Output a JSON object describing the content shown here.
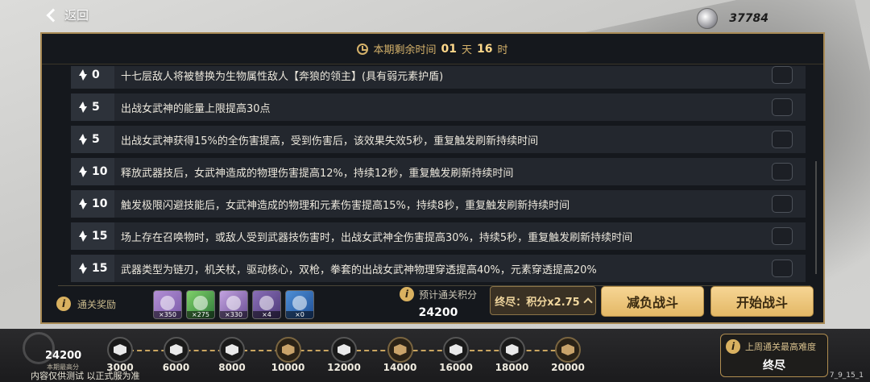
{
  "topbar": {
    "back_label": "返回",
    "currency_value": "37784",
    "currency_icon": "currency-emblem-icon"
  },
  "timer": {
    "prefix": "本期剩余时间",
    "days": "01",
    "day_unit": "天",
    "hours": "16",
    "hour_unit": "时"
  },
  "rules": [
    {
      "cost": "0",
      "text": "十七层敌人将被替换为生物属性敌人【奔狼的领主】(具有弱元素护盾)"
    },
    {
      "cost": "5",
      "text": "出战女武神的能量上限提高30点"
    },
    {
      "cost": "5",
      "text": "出战女武神获得15%的全伤害提高，受到伤害后，该效果失效5秒，重复触发刷新持续时间"
    },
    {
      "cost": "10",
      "text": "释放武器技后，女武神造成的物理伤害提高12%，持续12秒，重复触发刷新持续时间"
    },
    {
      "cost": "10",
      "text": "触发极限闪避技能后，女武神造成的物理和元素伤害提高15%，持续8秒，重复触发刷新持续时间"
    },
    {
      "cost": "15",
      "text": "场上存在召唤物时，或敌人受到武器技伤害时，出战女武神全伤害提高30%，持续5秒，重复触发刷新持续时间"
    },
    {
      "cost": "15",
      "text": "武器类型为链刃，机关杖，驱动核心，双枪，拳套的出战女武神物理穿透提高40%，元素穿透提高20%"
    }
  ],
  "rewards": {
    "label": "通关奖励",
    "items": [
      {
        "qty": "×350"
      },
      {
        "qty": "×275"
      },
      {
        "qty": "×330"
      },
      {
        "qty": "×4"
      },
      {
        "qty": "×0"
      }
    ]
  },
  "score": {
    "label": "预计通关积分",
    "value": "24200"
  },
  "actions": {
    "multiplier": "终尽：积分x2.75",
    "reduce": "减负战斗",
    "start": "开始战斗"
  },
  "progress": {
    "current_score": "24200",
    "current_label": "本期最高分",
    "milestones": [
      {
        "value": "3000",
        "claimed": false
      },
      {
        "value": "6000",
        "claimed": false
      },
      {
        "value": "8000",
        "claimed": false
      },
      {
        "value": "10000",
        "claimed": true
      },
      {
        "value": "12000",
        "claimed": false
      },
      {
        "value": "14000",
        "claimed": true
      },
      {
        "value": "16000",
        "claimed": false
      },
      {
        "value": "18000",
        "claimed": false
      },
      {
        "value": "20000",
        "claimed": true
      }
    ]
  },
  "last_week": {
    "label": "上周通关最高难度",
    "value": "终尽"
  },
  "watermark": "内容仅供测试 以正式服为准",
  "version": "7_9_15_1"
}
